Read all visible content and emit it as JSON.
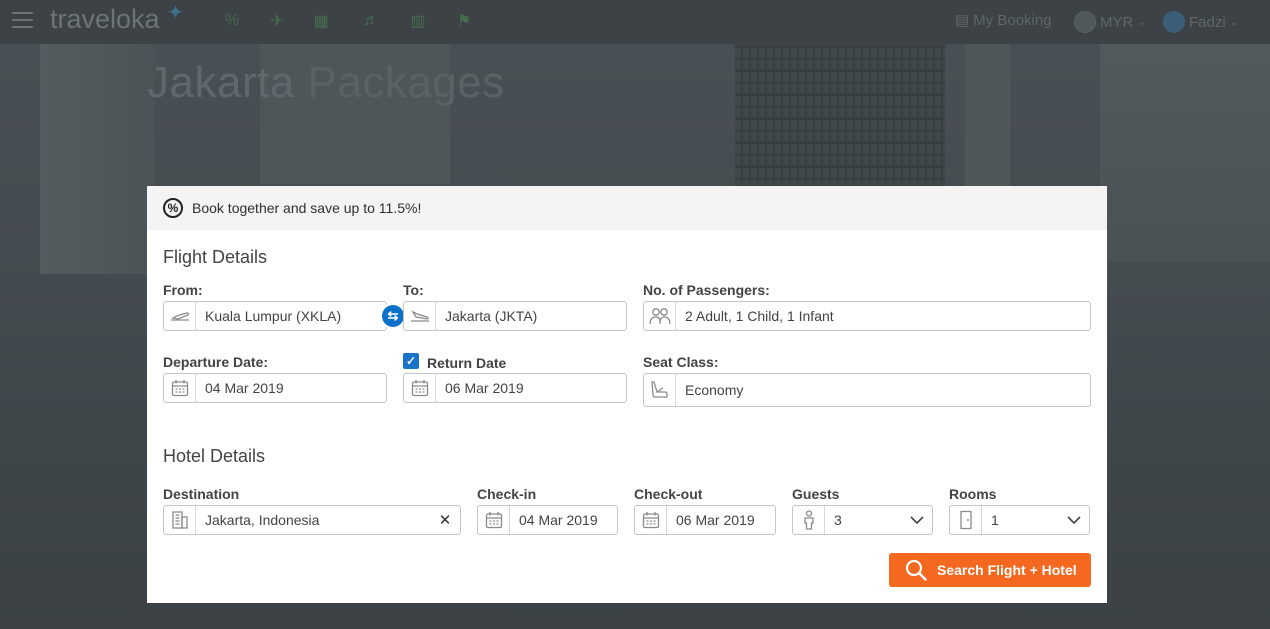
{
  "hero": {
    "title_part1": "Jakarta",
    "title_part2": "Packages"
  },
  "nav": {
    "logo": "traveloka",
    "my_booking": "My Booking",
    "currency": "MYR",
    "user": "Fadzi",
    "icons": [
      "percent-icon",
      "plane-icon",
      "hotel-icon",
      "train-icon",
      "bus-icon",
      "activity-icon"
    ]
  },
  "promo": {
    "text": "Book together and save up to 11.5%!"
  },
  "flight": {
    "section_title": "Flight Details",
    "from_label": "From:",
    "from_value": "Kuala Lumpur (XKLA)",
    "to_label": "To:",
    "to_value": "Jakarta (JKTA)",
    "passengers_label": "No. of Passengers:",
    "passengers_value": "2 Adult, 1 Child, 1 Infant",
    "departure_label": "Departure Date:",
    "departure_value": "04 Mar 2019",
    "return_label": "Return Date",
    "return_checked": true,
    "return_value": "06 Mar 2019",
    "seat_label": "Seat Class:",
    "seat_value": "Economy"
  },
  "hotel": {
    "section_title": "Hotel Details",
    "destination_label": "Destination",
    "destination_value": "Jakarta, Indonesia",
    "checkin_label": "Check-in",
    "checkin_value": "04 Mar 2019",
    "checkout_label": "Check-out",
    "checkout_value": "06 Mar 2019",
    "guests_label": "Guests",
    "guests_value": "3",
    "rooms_label": "Rooms",
    "rooms_value": "1"
  },
  "search_button": {
    "label": "Search Flight + Hotel"
  },
  "colors": {
    "accent": "#f4681f",
    "primary_blue": "#0a70c9",
    "text": "#434343"
  }
}
